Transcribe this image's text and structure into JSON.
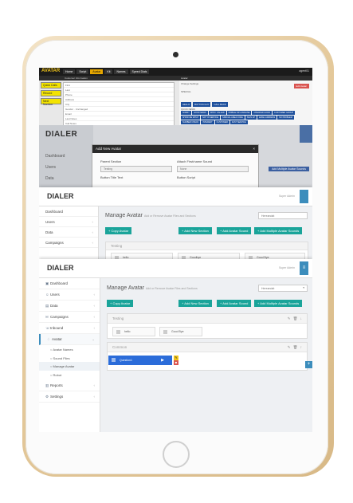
{
  "device": {
    "type": "tablet"
  },
  "layer1": {
    "logo": "AVATAR",
    "menu": [
      "Home",
      "Script",
      "Avatar",
      "Kit",
      "Names",
      "Speed Dials"
    ],
    "active_menu_index": 2,
    "user": "agent01",
    "sub_left": "Customer Information",
    "sub_right": "Avatar",
    "side_buttons": [
      "Quick Calls",
      "Record",
      "Next Number"
    ],
    "form_rows": [
      "First",
      "Last",
      "Phone",
      "Address",
      "City",
      "Gender",
      "Email",
      "Last Notes",
      "Call Notes"
    ],
    "select_value": "Unchanged",
    "right_labels": [
      "Change Settings",
      "SPECIAL"
    ],
    "chips_top": [
      "HELLO",
      "BUTTON GUY",
      "CALL BACK"
    ],
    "chips_label": "QUICK NEWS",
    "chips": [
      "SORRY",
      "GOOD NEWS",
      "WHO I CALLED",
      "MOBILE OR LANDLINE",
      "CHECKED GOOD",
      "CUSTOMER GROUP",
      "SHOW ME WHAT",
      "NOT IN SERVICE",
      "SPECIAL AREA CODE",
      "SIGN UP",
      "EMAIL ADDRESS",
      "NO PROBLEM",
      "NUMBER CHECK",
      "INTEREST",
      "CUSTOMER",
      "FAST SERVICE"
    ],
    "red_button": "Edit Avatar"
  },
  "layer2": {
    "logo": "DIALER",
    "side_items": [
      "Dashboard",
      "Users",
      "Data"
    ],
    "modal_title": "Add New Avatar",
    "modal_close": "×",
    "parent_section_label": "Parent Section",
    "parent_section_value": "Testing",
    "attach_sound_label": "Attach First/name Sound",
    "attach_sound_value": "None",
    "button_title_label": "Button Title Text",
    "button_script_label": "Button Script",
    "bg_button": "Add Multiple Avatar Sounds"
  },
  "layer3": {
    "logo": "DIALER",
    "admin": "Super Admin",
    "side_items": [
      "Dashboard",
      "Users",
      "Data",
      "Campaigns"
    ],
    "title": "Manage Avatar",
    "subtitle": "Add or Remove Avatar Files and Sections",
    "select_value": "Hereandat",
    "buttons": {
      "copy": "+ Copy Avatar",
      "section": "+ Add New Section",
      "sound": "+ Add Avatar Sound",
      "multi": "+ Add Multiple Avatar Sounds"
    },
    "panel_title": "Testing",
    "tiles": [
      "hello",
      "Goodbye",
      "Good Bye"
    ]
  },
  "layer4": {
    "logo": "DIALER",
    "admin": "Super Admin",
    "menu_icon": "≡",
    "side_items": [
      {
        "label": "Dashboard",
        "icon": "▣"
      },
      {
        "label": "Users",
        "icon": "☺"
      },
      {
        "label": "Data",
        "icon": "▤"
      },
      {
        "label": "Campaigns",
        "icon": "✉"
      },
      {
        "label": "Inbound",
        "icon": "☏"
      },
      {
        "label": "Avatar",
        "icon": "♢"
      }
    ],
    "avatar_sub": [
      "Avatar Names",
      "Sound Files",
      "Manage Avatar",
      "Robot"
    ],
    "bottom_items": [
      {
        "label": "Reports",
        "icon": "▥"
      },
      {
        "label": "Settings",
        "icon": "⚙"
      }
    ],
    "title": "Manage Avatar",
    "subtitle": "Add or Remove Avatar Files and Sections",
    "select_value": "Hereandat",
    "buttons": {
      "copy": "+ Copy Avatar",
      "section": "+ Add New Section",
      "sound": "+ Add Avatar Sound",
      "multi": "+ Add Multiple Avatar Sounds"
    },
    "panel_testing": {
      "title": "Testing",
      "tools": "✎ 🗑 ↓",
      "tiles": [
        "hello",
        "Good Bye"
      ]
    },
    "panel_common": {
      "title": "Common",
      "tools": "✎ 🗑 ↑",
      "avatar_tile": "Question1",
      "play": "▶",
      "edit": "✎",
      "del": "■"
    },
    "plus": "+"
  },
  "colors": {
    "teal": "#1aa49a",
    "blue": "#3c8dbc",
    "avatar_blue": "#2b6cd9",
    "yellow": "#f0c419",
    "red": "#d9534f"
  }
}
